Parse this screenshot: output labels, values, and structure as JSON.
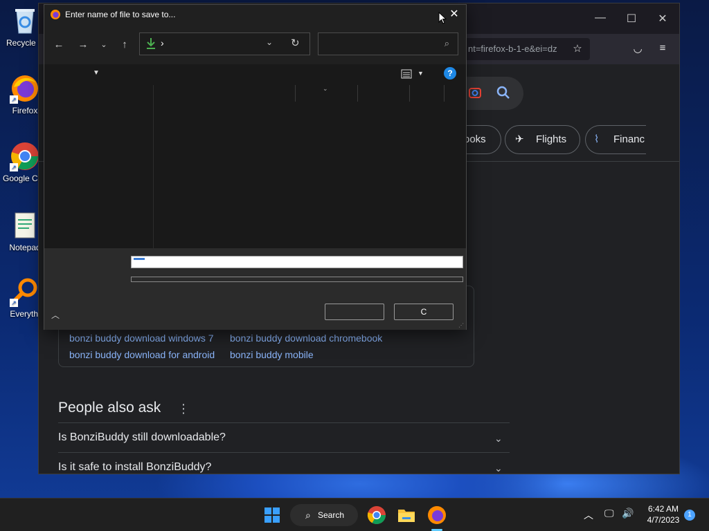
{
  "desktop": {
    "icons": [
      {
        "label": "Recycle B",
        "icon": "recycle-bin-icon"
      },
      {
        "label": "Firefox",
        "icon": "firefox-icon"
      },
      {
        "label": "Google Chrom",
        "icon": "chrome-icon"
      },
      {
        "label": "Notepad",
        "icon": "notepad-icon"
      },
      {
        "label": "Everythi",
        "icon": "everything-search-icon"
      }
    ]
  },
  "browser": {
    "url_fragment": "nt=firefox-b-1-e&ei=dz",
    "chips": [
      "ooks",
      "Flights",
      "Financ"
    ],
    "related_searches": [
      "bonzi buddy download windows 7",
      "bonzi buddy download chromebook",
      "bonzi buddy download for android",
      "bonzi buddy mobile"
    ],
    "people_also_ask": {
      "title": "People also ask",
      "questions": [
        "Is BonziBuddy still downloadable?",
        "Is it safe to install BonziBuddy?"
      ]
    }
  },
  "dialog": {
    "title": "Enter name of file to save to...",
    "address_chevron": "›",
    "cancel_label": "C",
    "save_label": ""
  },
  "taskbar": {
    "search_label": "Search",
    "time": "6:42 AM",
    "date": "4/7/2023",
    "notification_count": "1"
  },
  "colors": {
    "accent": "#3a7bd5",
    "link": "#8ab4f8",
    "download_arrow": "#4caf50"
  }
}
